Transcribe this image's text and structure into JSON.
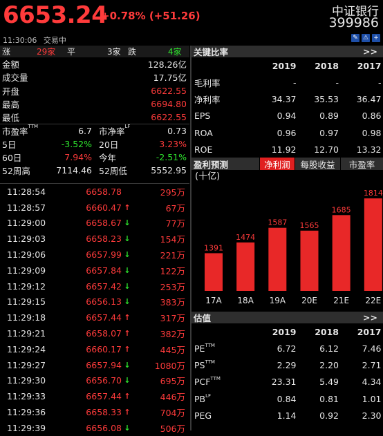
{
  "header": {
    "price": "6653.24",
    "change": "+0.78% (+51.26)",
    "name": "中证银行",
    "code": "399986",
    "time": "11:30:06",
    "status": "交易中",
    "icons": [
      "note-icon",
      "alert-icon",
      "add-icon"
    ]
  },
  "updown": {
    "up_label": "涨",
    "up_count": "29家",
    "flat_label": "平",
    "flat_count": "3家",
    "down_label": "跌",
    "down_count": "4家"
  },
  "stats": [
    {
      "label": "金额",
      "value": "128.26亿",
      "color": "white"
    },
    {
      "label": "成交量",
      "value": "17.75亿",
      "color": "white"
    },
    {
      "label": "开盘",
      "value": "6622.55",
      "color": "red"
    },
    {
      "label": "最高",
      "value": "6694.80",
      "color": "red"
    },
    {
      "label": "最低",
      "value": "6622.55",
      "color": "red"
    }
  ],
  "pairs": [
    {
      "l1": "市盈率",
      "s1": "TTM",
      "v1": "6.7",
      "c1": "white",
      "l2": "市净率",
      "s2": "LF",
      "v2": "0.73",
      "c2": "white"
    },
    {
      "l1": "5日",
      "s1": "",
      "v1": "-3.52%",
      "c1": "green",
      "l2": "20日",
      "s2": "",
      "v2": "3.23%",
      "c2": "red"
    },
    {
      "l1": "60日",
      "s1": "",
      "v1": "7.94%",
      "c1": "red",
      "l2": "今年",
      "s2": "",
      "v2": "-2.51%",
      "c2": "green"
    },
    {
      "l1": "52周高",
      "s1": "",
      "v1": "7114.46",
      "c1": "white",
      "l2": "52周低",
      "s2": "",
      "v2": "5552.95",
      "c2": "white"
    }
  ],
  "ticks": [
    {
      "time": "11:28:54",
      "price": "6658.78",
      "arrow": "",
      "vol": "295万",
      "pc": "red",
      "vc": "red"
    },
    {
      "time": "11:28:57",
      "price": "6660.47",
      "arrow": "up",
      "vol": "67万",
      "pc": "red",
      "vc": "red"
    },
    {
      "time": "11:29:00",
      "price": "6658.67",
      "arrow": "down",
      "vol": "77万",
      "pc": "red",
      "vc": "red"
    },
    {
      "time": "11:29:03",
      "price": "6658.23",
      "arrow": "down",
      "vol": "154万",
      "pc": "red",
      "vc": "red"
    },
    {
      "time": "11:29:06",
      "price": "6657.99",
      "arrow": "down",
      "vol": "221万",
      "pc": "red",
      "vc": "red"
    },
    {
      "time": "11:29:09",
      "price": "6657.84",
      "arrow": "down",
      "vol": "122万",
      "pc": "red",
      "vc": "red"
    },
    {
      "time": "11:29:12",
      "price": "6657.42",
      "arrow": "down",
      "vol": "253万",
      "pc": "red",
      "vc": "red"
    },
    {
      "time": "11:29:15",
      "price": "6656.13",
      "arrow": "down",
      "vol": "383万",
      "pc": "red",
      "vc": "red"
    },
    {
      "time": "11:29:18",
      "price": "6657.44",
      "arrow": "up",
      "vol": "317万",
      "pc": "red",
      "vc": "red"
    },
    {
      "time": "11:29:21",
      "price": "6658.07",
      "arrow": "up",
      "vol": "382万",
      "pc": "red",
      "vc": "red"
    },
    {
      "time": "11:29:24",
      "price": "6660.17",
      "arrow": "up",
      "vol": "445万",
      "pc": "red",
      "vc": "red"
    },
    {
      "time": "11:29:27",
      "price": "6657.94",
      "arrow": "down",
      "vol": "1080万",
      "pc": "red",
      "vc": "red"
    },
    {
      "time": "11:29:30",
      "price": "6656.70",
      "arrow": "down",
      "vol": "695万",
      "pc": "red",
      "vc": "red"
    },
    {
      "time": "11:29:33",
      "price": "6657.44",
      "arrow": "up",
      "vol": "446万",
      "pc": "red",
      "vc": "red"
    },
    {
      "time": "11:29:36",
      "price": "6658.33",
      "arrow": "up",
      "vol": "704万",
      "pc": "red",
      "vc": "red"
    },
    {
      "time": "11:29:39",
      "price": "6656.08",
      "arrow": "down",
      "vol": "506万",
      "pc": "red",
      "vc": "red"
    }
  ],
  "ratios": {
    "title": "关键比率",
    "more": ">>",
    "years": [
      "2019",
      "2018",
      "2017"
    ],
    "rows": [
      {
        "label": "毛利率",
        "sup": "",
        "values": [
          "-",
          "-",
          "-"
        ]
      },
      {
        "label": "净利率",
        "sup": "",
        "values": [
          "34.37",
          "35.53",
          "36.47"
        ]
      },
      {
        "label": "EPS",
        "sup": "",
        "values": [
          "0.94",
          "0.89",
          "0.86"
        ]
      },
      {
        "label": "ROA",
        "sup": "",
        "values": [
          "0.96",
          "0.97",
          "0.98"
        ]
      },
      {
        "label": "ROE",
        "sup": "",
        "values": [
          "11.92",
          "12.70",
          "13.32"
        ]
      }
    ]
  },
  "forecast": {
    "title": "盈利预测",
    "tabs": [
      "净利润",
      "每股收益",
      "市盈率"
    ],
    "active_tab": 0,
    "unit": "(十亿)"
  },
  "valuation": {
    "title": "估值",
    "more": ">>",
    "years": [
      "2019",
      "2018",
      "2017"
    ],
    "rows": [
      {
        "label": "PE",
        "sup": "TTM",
        "values": [
          "6.72",
          "6.12",
          "7.46"
        ]
      },
      {
        "label": "PS",
        "sup": "TTM",
        "values": [
          "2.29",
          "2.20",
          "2.71"
        ]
      },
      {
        "label": "PCF",
        "sup": "TTM",
        "values": [
          "23.31",
          "5.49",
          "4.34"
        ]
      },
      {
        "label": "PB",
        "sup": "LF",
        "values": [
          "0.84",
          "0.81",
          "1.01"
        ]
      },
      {
        "label": "PEG",
        "sup": "",
        "values": [
          "1.14",
          "0.92",
          "2.30"
        ]
      }
    ]
  },
  "colors": {
    "up": "#ff3b3b",
    "down": "#2ee52e",
    "accent": "#e02020",
    "panel": "#2e2e2e"
  },
  "chart_data": {
    "type": "bar",
    "categories": [
      "17A",
      "18A",
      "19A",
      "20E",
      "21E",
      "22E"
    ],
    "values": [
      1391,
      1474,
      1587,
      1565,
      1685,
      1814
    ],
    "ylim": [
      1100,
      1900
    ],
    "color": "#e82828"
  }
}
